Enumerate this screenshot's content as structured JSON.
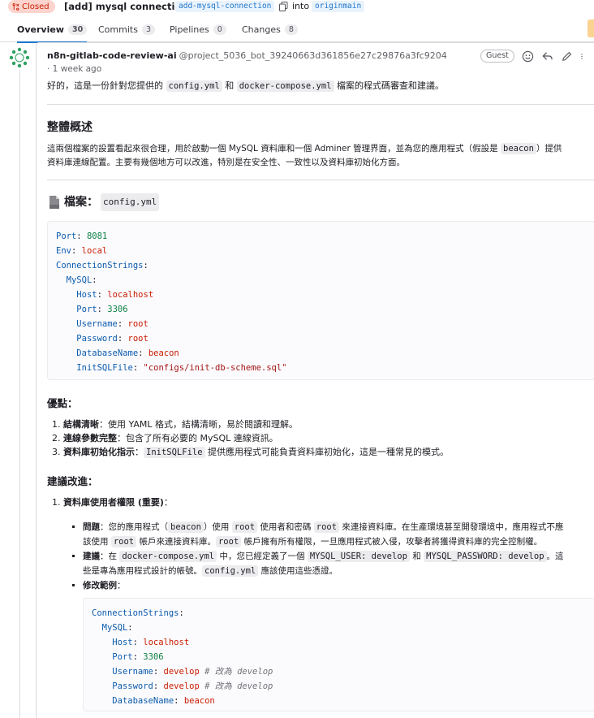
{
  "header": {
    "status": "Closed",
    "title": "[add] mysql connection",
    "source_branch": "add-mysql-connection",
    "into": "into",
    "target_branch": "originmain"
  },
  "tabs": [
    {
      "label": "Overview",
      "count": "30"
    },
    {
      "label": "Commits",
      "count": "3"
    },
    {
      "label": "Pipelines",
      "count": "0"
    },
    {
      "label": "Changes",
      "count": "8"
    }
  ],
  "note": {
    "author": "n8n-gitlab-code-review-ai",
    "handle": "@project_5036_bot_39240663d361856e27c29876a3fc9204",
    "time": "· 1 week ago",
    "role": "Guest",
    "intro_a": "好的，這是一份針對您提供的",
    "intro_code1": "config.yml",
    "intro_b": "和",
    "intro_code2": "docker-compose.yml",
    "intro_c": "檔案的程式碼審查和建議。",
    "overview_h": "整體概述",
    "overview_a": "這兩個檔案的設置看起來很合理，用於啟動一個 MySQL 資料庫和一個 Adminer 管理界面，並為您的應用程式（假設是",
    "overview_code": "beacon",
    "overview_b": "）提供",
    "overview_c": "資料庫連線配置。主要有幾個地方可以改進，特別是在安全性、一致性以及資料庫初始化方面。",
    "file_h": "檔案：",
    "file_code": "config.yml",
    "pros_h": "優點：",
    "pros": [
      {
        "bold": "結構清晰",
        "text": "：使用 YAML 格式，結構清晰，易於閱讀和理解。"
      },
      {
        "bold": "連線參數完整",
        "text": "：包含了所有必要的 MySQL 連線資訊。"
      },
      {
        "bold": "資料庫初始化指示",
        "text_a": "：",
        "code": "InitSQLFile",
        "text_b": " 提供應用程式可能負責資料庫初始化，這是一種常見的模式。"
      }
    ],
    "improve_h": "建議改進：",
    "item1_bold": "資料庫使用者權限 (重要)",
    "item1_tail": "：",
    "problem_label": "問題",
    "problem_a": "：您的應用程式（",
    "problem_code1": "beacon",
    "problem_b": "）使用",
    "problem_code2": "root",
    "problem_c": "使用者和密碼",
    "problem_code3": "root",
    "problem_d": "來連接資料庫。在生產環境甚至開發環境中，應用程式不應",
    "problem_e": "該使用",
    "problem_code4": "root",
    "problem_f": "帳戶來連接資料庫。",
    "problem_code5": "root",
    "problem_g": "帳戶擁有所有權限，一旦應用程式被入侵，攻擊者將獲得資料庫的完全控制權。",
    "suggest_label": "建議",
    "suggest_a": "：在",
    "suggest_code1": "docker-compose.yml",
    "suggest_b": "中，您已經定義了一個",
    "suggest_code2": "MYSQL_USER: develop",
    "suggest_c": "和",
    "suggest_code3": "MYSQL_PASSWORD: develop",
    "suggest_d": "。這",
    "suggest_e": "些是專為應用程式設計的帳號。",
    "suggest_code4": "config.yml",
    "suggest_f": "應該使用這些憑證。",
    "example_label": "修改範例",
    "example_tail": "："
  },
  "config_code": [
    [
      [
        "k",
        "Port"
      ],
      [
        "p",
        ": "
      ],
      [
        "n",
        "8081"
      ]
    ],
    [
      [
        "k",
        "Env"
      ],
      [
        "p",
        ": "
      ],
      [
        "v",
        "local"
      ]
    ],
    [
      [
        "k",
        "ConnectionStrings"
      ],
      [
        "p",
        ":"
      ]
    ],
    [
      [
        "p",
        "  "
      ],
      [
        "k",
        "MySQL"
      ],
      [
        "p",
        ":"
      ]
    ],
    [
      [
        "p",
        "    "
      ],
      [
        "k",
        "Host"
      ],
      [
        "p",
        ": "
      ],
      [
        "v",
        "localhost"
      ]
    ],
    [
      [
        "p",
        "    "
      ],
      [
        "k",
        "Port"
      ],
      [
        "p",
        ": "
      ],
      [
        "n",
        "3306"
      ]
    ],
    [
      [
        "p",
        "    "
      ],
      [
        "k",
        "Username"
      ],
      [
        "p",
        ": "
      ],
      [
        "v",
        "root"
      ]
    ],
    [
      [
        "p",
        "    "
      ],
      [
        "k",
        "Password"
      ],
      [
        "p",
        ": "
      ],
      [
        "v",
        "root"
      ]
    ],
    [
      [
        "p",
        "    "
      ],
      [
        "k",
        "DatabaseName"
      ],
      [
        "p",
        ": "
      ],
      [
        "v",
        "beacon"
      ]
    ],
    [
      [
        "p",
        "    "
      ],
      [
        "k",
        "InitSQLFile"
      ],
      [
        "p",
        ": "
      ],
      [
        "s",
        "\"configs/init-db-scheme.sql\""
      ]
    ]
  ],
  "example_code": [
    [
      [
        "k",
        "ConnectionStrings"
      ],
      [
        "p",
        ":"
      ]
    ],
    [
      [
        "p",
        "  "
      ],
      [
        "k",
        "MySQL"
      ],
      [
        "p",
        ":"
      ]
    ],
    [
      [
        "p",
        "    "
      ],
      [
        "k",
        "Host"
      ],
      [
        "p",
        ": "
      ],
      [
        "v",
        "localhost"
      ]
    ],
    [
      [
        "p",
        "    "
      ],
      [
        "k",
        "Port"
      ],
      [
        "p",
        ": "
      ],
      [
        "n",
        "3306"
      ]
    ],
    [
      [
        "p",
        "    "
      ],
      [
        "k",
        "Username"
      ],
      [
        "p",
        ": "
      ],
      [
        "v",
        "develop"
      ],
      [
        "c",
        " # 改為 develop"
      ]
    ],
    [
      [
        "p",
        "    "
      ],
      [
        "k",
        "Password"
      ],
      [
        "p",
        ": "
      ],
      [
        "v",
        "develop"
      ],
      [
        "c",
        " # 改為 develop"
      ]
    ],
    [
      [
        "p",
        "    "
      ],
      [
        "k",
        "DatabaseName"
      ],
      [
        "p",
        ": "
      ],
      [
        "v",
        "beacon"
      ]
    ]
  ]
}
